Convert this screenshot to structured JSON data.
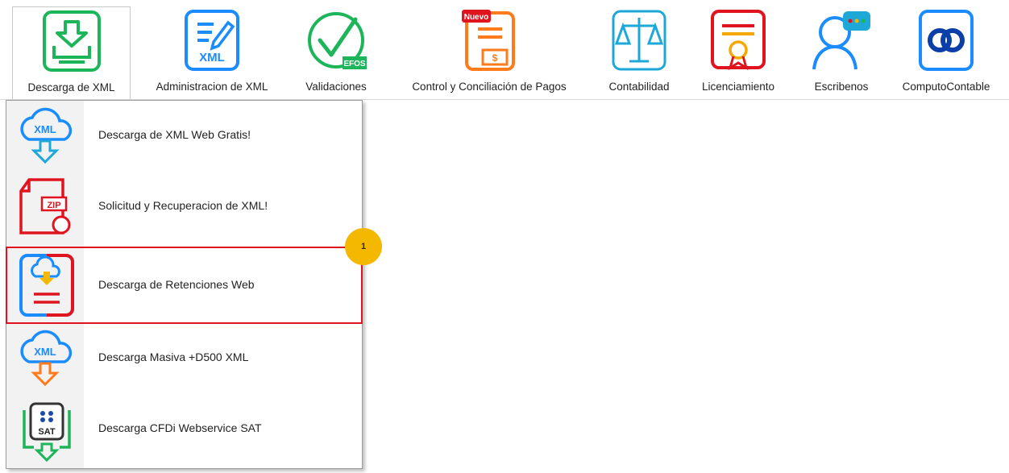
{
  "toolbar": {
    "items": [
      {
        "label": "Descarga de XML",
        "icon": "download-tray-icon"
      },
      {
        "label": "Administracion de XML",
        "icon": "xml-edit-icon",
        "icon_text": "XML"
      },
      {
        "label": "Validaciones",
        "icon": "check-circle-icon",
        "icon_text": "EFOS"
      },
      {
        "label": "Control y Conciliación de Pagos",
        "icon": "payments-document-icon",
        "icon_text": "Nuevo"
      },
      {
        "label": "Contabilidad",
        "icon": "balance-scale-icon"
      },
      {
        "label": "Licenciamiento",
        "icon": "certificate-icon"
      },
      {
        "label": "Escribenos",
        "icon": "chat-user-icon"
      },
      {
        "label": "ComputoContable",
        "icon": "computocontable-logo-icon"
      }
    ]
  },
  "dropdown": {
    "items": [
      {
        "label": "Descarga de XML Web Gratis!",
        "icon": "xml-cloud-download-icon",
        "icon_text": "XML"
      },
      {
        "label": "Solicitud y Recuperacion de XML!",
        "icon": "zip-file-refresh-icon",
        "icon_text": "ZIP"
      },
      {
        "label": "Descarga de Retenciones Web",
        "icon": "cloud-document-download-icon"
      },
      {
        "label": "Descarga Masiva +D500 XML",
        "icon": "xml-cloud-bulk-download-icon",
        "icon_text": "XML"
      },
      {
        "label": "Descarga CFDi Webservice SAT",
        "icon": "sat-webservice-icon",
        "icon_text": "SAT"
      }
    ]
  },
  "annotation": {
    "badge": "1"
  },
  "colors": {
    "highlight": "#e0141e",
    "badge": "#f5b800",
    "green": "#1db55a",
    "blue": "#1a8cff",
    "orange": "#ff7a1a",
    "red": "#e0141e"
  }
}
